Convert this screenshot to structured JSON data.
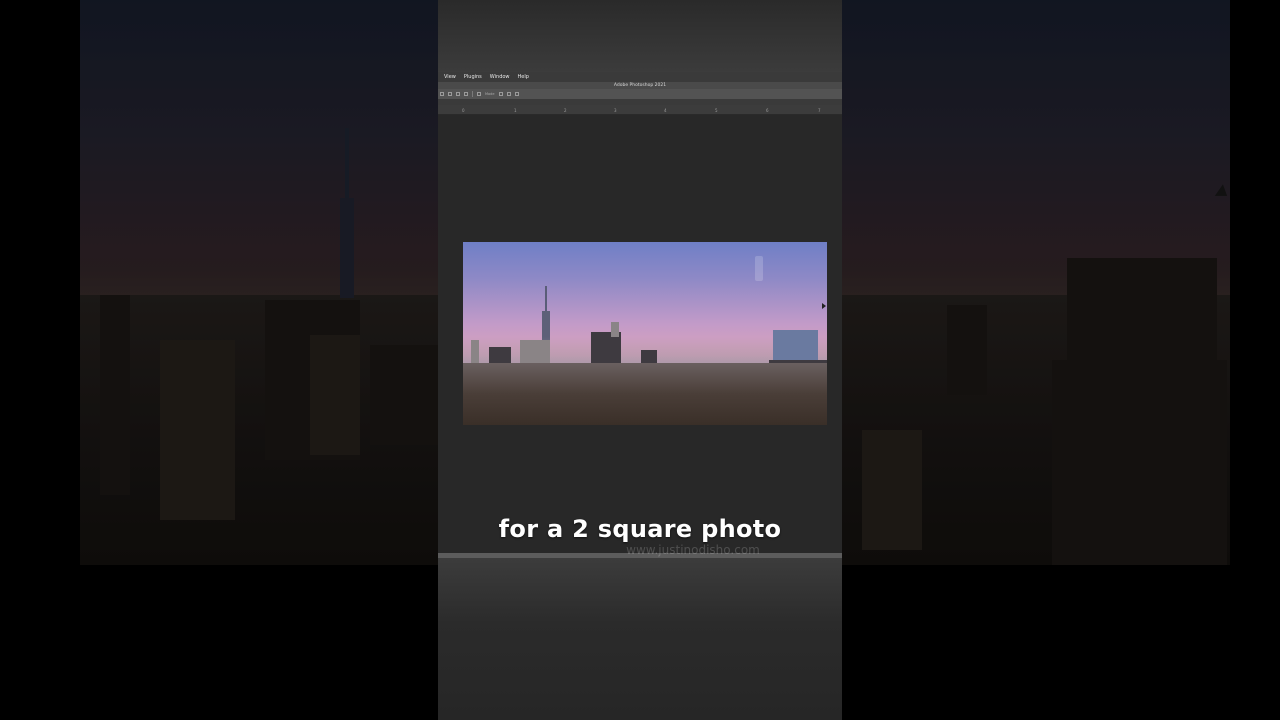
{
  "menu": {
    "items": [
      "View",
      "Plugins",
      "Window",
      "Help"
    ]
  },
  "app": {
    "title": "Adobe Photoshop 2021"
  },
  "options": {
    "label": "Mode"
  },
  "ruler": {
    "ticks": [
      "0",
      "1",
      "2",
      "3",
      "4",
      "5",
      "6",
      "7"
    ]
  },
  "caption": {
    "text": "for a 2 square photo"
  },
  "watermark": {
    "text": "www.justinodisho.com"
  },
  "colors": {
    "accent_caption": "#ffffff",
    "canvas_bg": "#282828",
    "menubar_bg": "#3a3a3a"
  },
  "icons": [
    "cursor-icon"
  ]
}
